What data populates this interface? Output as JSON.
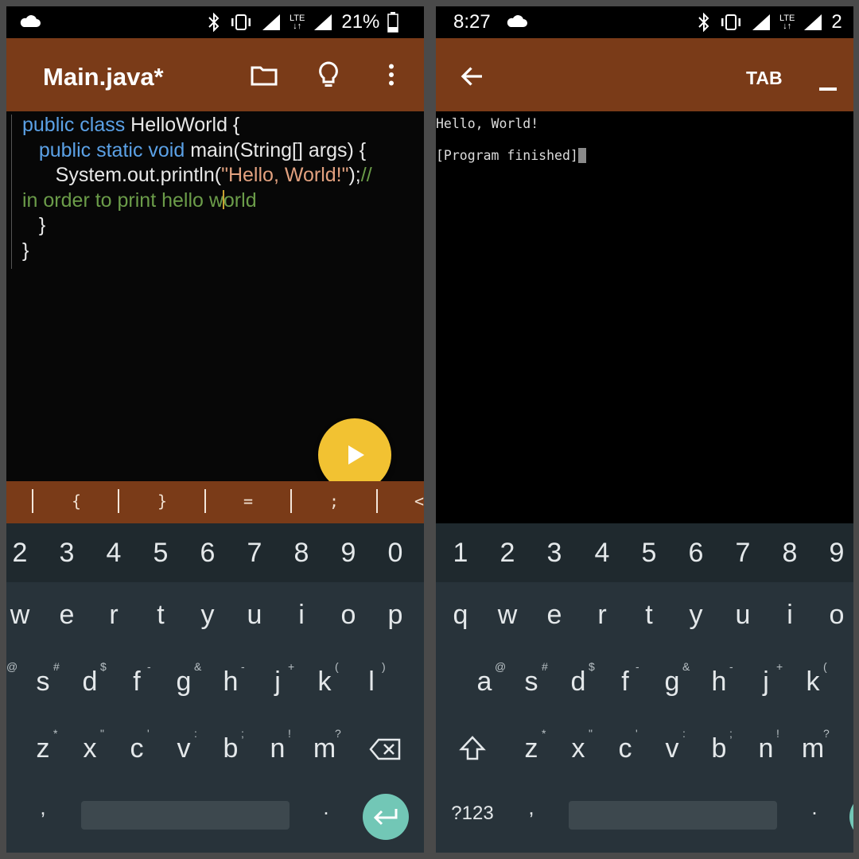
{
  "left": {
    "status": {
      "battery": "21%",
      "network": "LTE"
    },
    "app_bar": {
      "title": "Main.java*",
      "icons": [
        "folder-icon",
        "lightbulb-icon",
        "more-vert-icon"
      ]
    },
    "code_lines": [
      "public class HelloWorld {",
      "public static void main(String[] args) {",
      "System.out.println(\"Hello, World!\");//",
      "in order to print hello world",
      "}",
      "}"
    ],
    "run_button": "play-icon",
    "symbol_bar": [
      "|",
      "{",
      "|",
      "}",
      "|",
      "=",
      "|",
      ";",
      "|",
      "<"
    ],
    "keyboard": {
      "numbers": [
        "2",
        "3",
        "4",
        "5",
        "6",
        "7",
        "8",
        "9",
        "0"
      ],
      "row1": [
        "w",
        "e",
        "r",
        "t",
        "y",
        "u",
        "i",
        "o",
        "p"
      ],
      "row2": [
        "s",
        "d",
        "f",
        "g",
        "h",
        "j",
        "k",
        "l"
      ],
      "row2_hints": [
        "@",
        "#",
        "$",
        "-",
        "&",
        "-",
        "+",
        "(",
        ")"
      ],
      "row3": [
        "z",
        "x",
        "c",
        "v",
        "b",
        "n",
        "m"
      ],
      "row3_hints": [
        "*",
        "\"",
        "'",
        ":",
        ";",
        "!",
        "?"
      ],
      "comma": ",",
      "period": "."
    }
  },
  "right": {
    "status": {
      "time": "8:27",
      "signal_partial": "2",
      "network": "LTE"
    },
    "app_bar": {
      "tab_label": "TAB",
      "icons": [
        "arrow-back-icon",
        "minimize-icon"
      ]
    },
    "terminal_lines": [
      "Hello, World!",
      "",
      "[Program finished]"
    ],
    "keyboard": {
      "numbers": [
        "1",
        "2",
        "3",
        "4",
        "5",
        "6",
        "7",
        "8",
        "9"
      ],
      "row1": [
        "q",
        "w",
        "e",
        "r",
        "t",
        "y",
        "u",
        "i",
        "o"
      ],
      "row2": [
        "a",
        "s",
        "d",
        "f",
        "g",
        "h",
        "j",
        "k"
      ],
      "row2_hints": [
        "@",
        "#",
        "$",
        "-",
        "&",
        "-",
        "+",
        "("
      ],
      "row3": [
        "z",
        "x",
        "c",
        "v",
        "b",
        "n",
        "m"
      ],
      "row3_hints": [
        "*",
        "\"",
        "'",
        ":",
        ";",
        "!",
        "?"
      ],
      "mode_key": "?123",
      "comma": ",",
      "period": "."
    }
  },
  "colors": {
    "app_bar": "#7a3b18",
    "fab": "#f2c232",
    "keyword": "#5ba1e6",
    "string": "#e2a17f",
    "comment": "#6b9c49",
    "enter_key": "#72c7b6",
    "keyboard_bg": "#28333a"
  }
}
